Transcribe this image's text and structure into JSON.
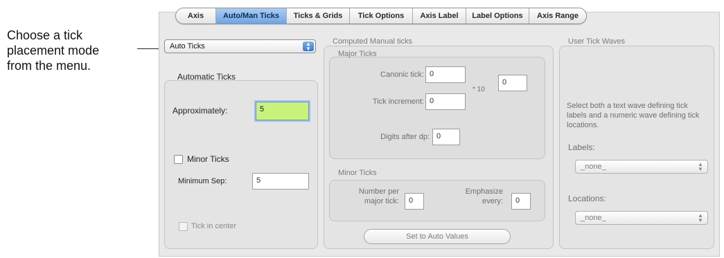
{
  "callout": {
    "text": "Choose a tick placement mode from the menu."
  },
  "tabs": [
    "Axis",
    "Auto/Man Ticks",
    "Ticks & Grids",
    "Tick Options",
    "Axis Label",
    "Label Options",
    "Axis Range"
  ],
  "active_tab": "Auto/Man Ticks",
  "mode_popup": {
    "value": "Auto Ticks"
  },
  "automatic": {
    "title": "Automatic Ticks",
    "approx_label": "Approximately:",
    "approx_value": "5",
    "minor_label": "Minor Ticks",
    "minsep_label": "Minimum Sep:",
    "minsep_value": "5",
    "center_label": "Tick in center"
  },
  "manual": {
    "title": "Computed Manual ticks",
    "major_title": "Major Ticks",
    "canonic_label": "Canonic tick:",
    "canonic_value": "0",
    "increment_label": "Tick increment:",
    "increment_value": "0",
    "times10_label": "* 10",
    "exponent_value": "0",
    "digits_label": "Digits after dp:",
    "digits_value": "0",
    "minor_title": "Minor Ticks",
    "number_per_label_1": "Number per",
    "number_per_label_2": "major tick:",
    "number_per_value": "0",
    "emphasize_label_1": "Emphasize",
    "emphasize_label_2": "every:",
    "emphasize_value": "0",
    "set_auto_button": "Set to Auto Values"
  },
  "waves": {
    "title": "User Tick Waves",
    "description": "Select both a text wave defining tick labels and a numeric wave defining tick locations.",
    "labels_label": "Labels:",
    "labels_value": "_none_",
    "locations_label": "Locations:",
    "locations_value": "_none_"
  }
}
